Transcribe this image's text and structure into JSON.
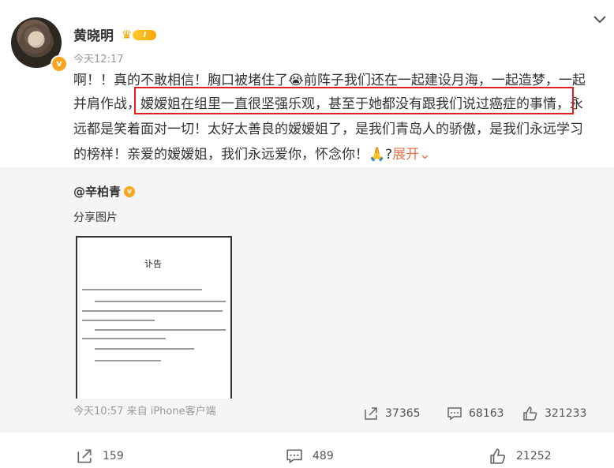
{
  "post": {
    "author": "黄晓明",
    "vip_level": "I",
    "time": "今天12:17",
    "lines": [
      {
        "parts": [
          {
            "t": "啊！！真的不敢相信！胸口被堵住了"
          },
          {
            "emoji": "😭"
          },
          {
            "t": "前阵子我们还在一起建设月海，一起造梦，一起"
          }
        ]
      },
      {
        "parts": [
          {
            "t": "并肩作战，"
          },
          {
            "t": "嫒嫒姐在组里一直很坚强乐观，甚至于她都没有跟我们说过癌症的事情"
          },
          {
            "t": "，永"
          }
        ]
      },
      {
        "parts": [
          {
            "t": "远都是笑着面对一切！太好太善良的嫒嫒姐了，是我们青岛人的骄傲，是我们永远学习"
          }
        ]
      },
      {
        "parts": [
          {
            "t": "的榜样！亲爱的嫒嫒姐，我们永远爱你，怀念你！"
          },
          {
            "emoji": "🙏"
          },
          {
            "t": "?"
          },
          {
            "link": "展开"
          }
        ]
      }
    ]
  },
  "repost": {
    "author": "@辛柏青",
    "share_label": "分享图片",
    "doc_title": "讣告",
    "time": "今天10:57 来自 iPhone客户端",
    "stats": {
      "reposts": "37365",
      "comments": "68163",
      "likes": "321233"
    }
  },
  "footer": {
    "reposts": "159",
    "comments": "489",
    "likes": "21252"
  },
  "colors": {
    "accent": "#eb7350",
    "highlight": "#e02020",
    "card_bg": "#f5f5f5",
    "badge": "#f5a623"
  }
}
